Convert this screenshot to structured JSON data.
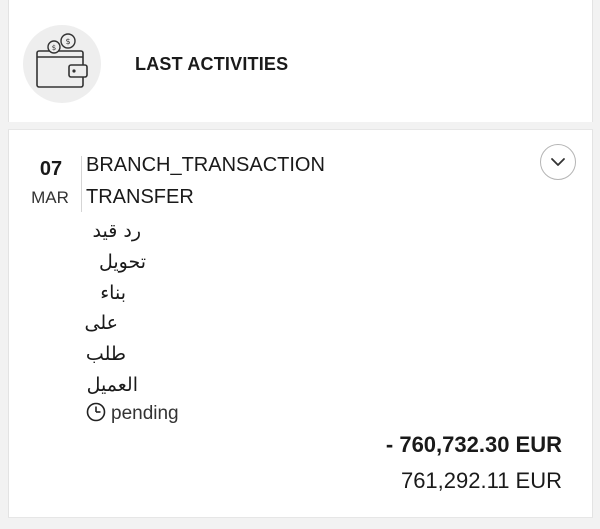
{
  "header": {
    "icon": "wallet-icon",
    "title": "LAST ACTIVITIES"
  },
  "transaction": {
    "day": "07",
    "month": "MAR",
    "description": [
      "BRANCH_TRANSACTION",
      "TRANSFER",
      "رد قيد",
      "تحويل",
      "بناء",
      "على",
      "طلب",
      "العميل"
    ],
    "status_icon": "clock-icon",
    "status": "pending",
    "expand_icon": "chevron-down-icon",
    "amount": "- 760,732.30 EUR",
    "balance": "761,292.11 EUR"
  },
  "colors": {
    "background": "#f2f2f2",
    "card": "#ffffff",
    "text": "#1a1a1a",
    "icon_circle": "#eeeeee"
  }
}
